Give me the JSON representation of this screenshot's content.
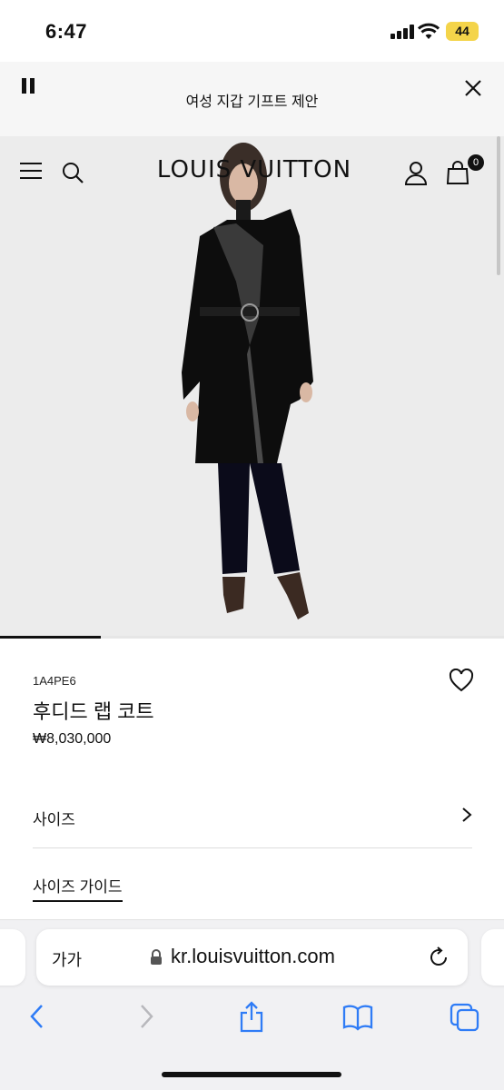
{
  "status_bar": {
    "time": "6:47",
    "battery": "44"
  },
  "promo": {
    "text": "여성 지갑 기프트 제안"
  },
  "header": {
    "brand": "LOUIS VUITTON",
    "bag_count": "0"
  },
  "gallery": {
    "progress": 0.2
  },
  "product": {
    "reference": "1A4PE6",
    "name": "후디드 랩 코트",
    "price": "₩8,030,000",
    "size_label": "사이즈",
    "size_guide_label": "사이즈 가이드"
  },
  "browser": {
    "text_size_label": "가가",
    "url": "kr.louisvuitton.com"
  },
  "colors": {
    "accent": "#111111",
    "ios_blue": "#2f7cf6",
    "battery": "#f4d44a"
  }
}
